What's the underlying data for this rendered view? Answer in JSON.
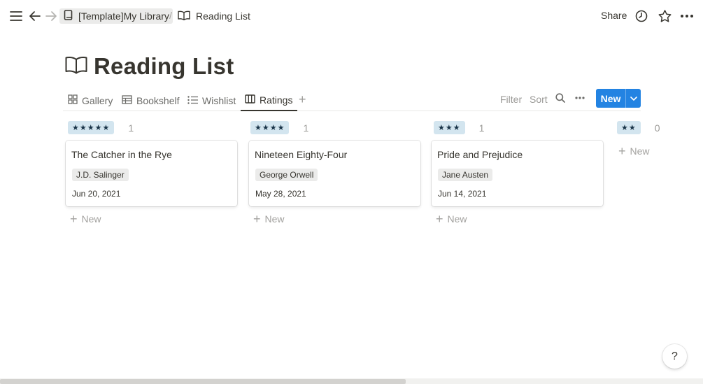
{
  "breadcrumb": {
    "library": "[Template]My Library",
    "separator": "/",
    "page": "Reading List"
  },
  "topbar": {
    "share_label": "Share",
    "icons": [
      "menu-icon",
      "back-arrow-icon",
      "forward-arrow-icon",
      "book-icon",
      "open-book-icon",
      "clock-icon",
      "star-icon",
      "more-icon"
    ]
  },
  "page": {
    "title": "Reading List"
  },
  "views": {
    "tabs": [
      {
        "label": "Gallery",
        "icon": "gallery-icon"
      },
      {
        "label": "Bookshelf",
        "icon": "table-icon"
      },
      {
        "label": "Wishlist",
        "icon": "list-icon"
      },
      {
        "label": "Ratings",
        "icon": "board-icon",
        "active": true
      }
    ],
    "filter_label": "Filter",
    "sort_label": "Sort",
    "new_label": "New"
  },
  "board": {
    "new_label": "New",
    "columns": [
      {
        "rating": "★★★★★",
        "count": "1",
        "cards": [
          {
            "title": "The Catcher in the Rye",
            "author": "J.D. Salinger",
            "date": "Jun 20, 2021"
          }
        ]
      },
      {
        "rating": "★★★★",
        "count": "1",
        "cards": [
          {
            "title": "Nineteen Eighty-Four",
            "author": "George Orwell",
            "date": "May 28, 2021"
          }
        ]
      },
      {
        "rating": "★★★",
        "count": "1",
        "cards": [
          {
            "title": "Pride and Prejudice",
            "author": "Jane Austen",
            "date": "Jun 14, 2021"
          }
        ]
      },
      {
        "rating": "★★",
        "count": "0",
        "cards": []
      }
    ]
  },
  "help": {
    "label": "?"
  },
  "colors": {
    "accent": "#2383e2",
    "rating_tag_bg": "#d3e5ef",
    "text": "#37352f",
    "muted": "#9b9a97"
  }
}
